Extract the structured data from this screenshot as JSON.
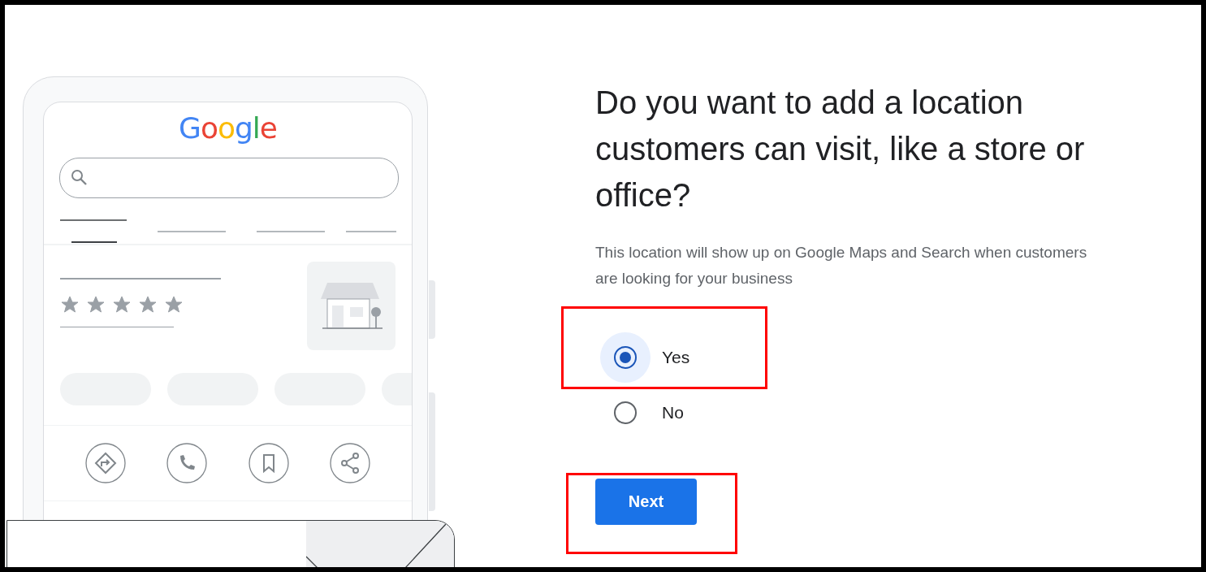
{
  "illustration": {
    "logo": "Google",
    "stars": 5
  },
  "question": {
    "title": "Do you want to add a location customers can visit, like a store or office?",
    "description": "This location will show up on Google Maps and Search when customers are looking for your business"
  },
  "options": [
    {
      "label": "Yes",
      "selected": true
    },
    {
      "label": "No",
      "selected": false
    }
  ],
  "next_button": {
    "label": "Next"
  }
}
